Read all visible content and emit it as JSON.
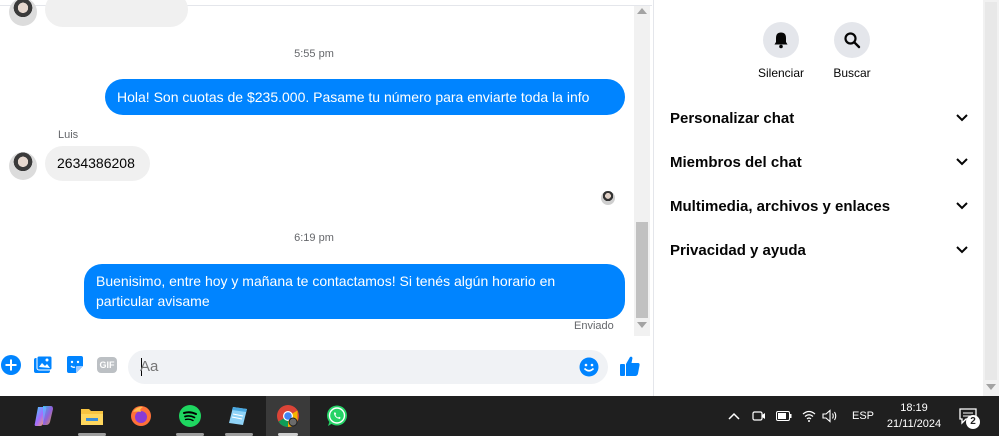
{
  "chat": {
    "time_1": "5:55 pm",
    "msg_out_1": "Hola! Son cuotas de $235.000. Pasame tu número para enviarte toda la info",
    "sender_name": "Luis",
    "msg_in_1": "2634386208",
    "time_2": "6:19 pm",
    "msg_out_2_line1": "Buenisimo, entre hoy y mañana te contactamos! Si tenés algún horario en",
    "msg_out_2_line2": "particular avisame",
    "status": "Enviado",
    "input_placeholder": "Aa",
    "accent_color": "#0084ff"
  },
  "composer": {
    "icons": [
      "plus-icon",
      "photo-icon",
      "sticker-icon",
      "gif-icon",
      "emoji-icon",
      "like-icon"
    ],
    "gif_label": "GIF"
  },
  "side": {
    "actions": [
      {
        "label": "Silenciar",
        "icon": "bell-icon"
      },
      {
        "label": "Buscar",
        "icon": "search-icon"
      }
    ],
    "sections": [
      {
        "label": "Personalizar chat"
      },
      {
        "label": "Miembros del chat"
      },
      {
        "label": "Multimedia, archivos y enlaces"
      },
      {
        "label": "Privacidad y ayuda"
      }
    ]
  },
  "taskbar": {
    "apps": [
      "copilot-icon",
      "file-explorer-icon",
      "firefox-icon",
      "spotify-icon",
      "notepad-icon",
      "chrome-icon",
      "whatsapp-icon"
    ],
    "language": "ESP",
    "time": "18:19",
    "date": "21/11/2024",
    "notification_count": "2"
  }
}
